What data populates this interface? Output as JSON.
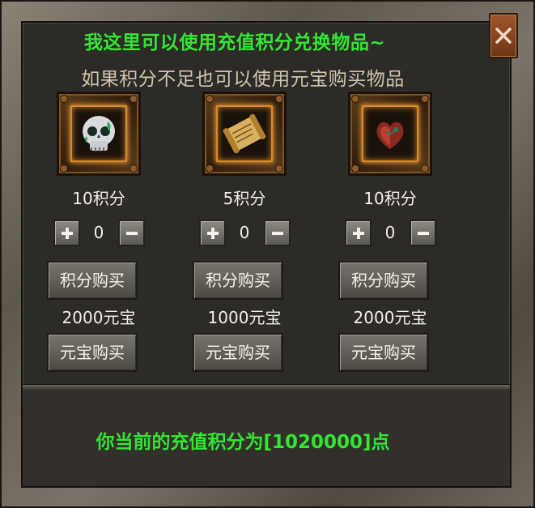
{
  "header": {
    "title": "我这里可以使用充值积分兑换物品~",
    "subtitle": "如果积分不足也可以使用元宝购买物品"
  },
  "close_icon": "close-icon",
  "items": [
    {
      "icon": "skull-icon",
      "score_price": "10积分",
      "quantity": "0",
      "score_buy_label": "积分购买",
      "gold_price": "2000元宝",
      "gold_buy_label": "元宝购买"
    },
    {
      "icon": "scroll-icon",
      "score_price": "5积分",
      "quantity": "0",
      "score_buy_label": "积分购买",
      "gold_price": "1000元宝",
      "gold_buy_label": "元宝购买"
    },
    {
      "icon": "heart-gem-icon",
      "score_price": "10积分",
      "quantity": "0",
      "score_buy_label": "积分购买",
      "gold_price": "2000元宝",
      "gold_buy_label": "元宝购买"
    }
  ],
  "footer": {
    "points_text": "你当前的充值积分为[1020000]点"
  },
  "colors": {
    "highlight_text": "#32e632",
    "subtitle_text": "#d0c4ad",
    "slot_glow": "#e89a3a"
  }
}
